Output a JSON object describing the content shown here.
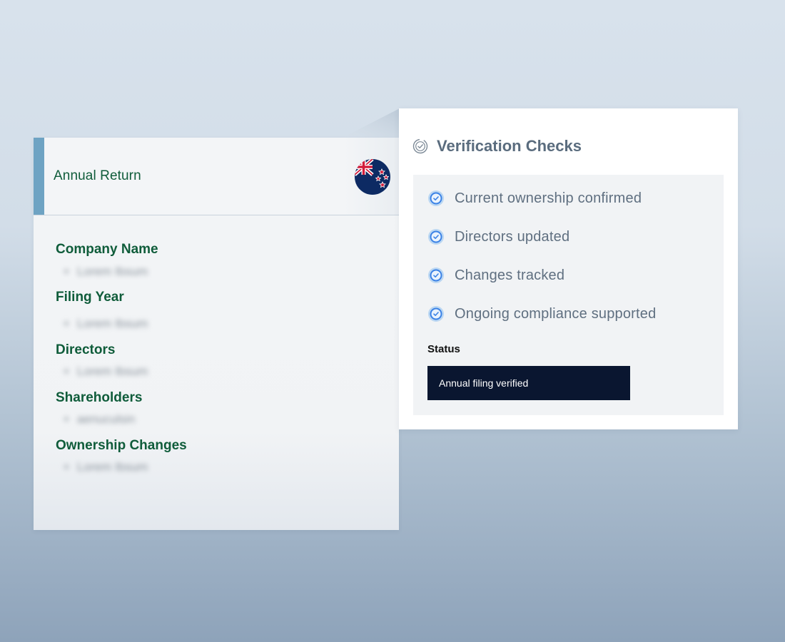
{
  "document": {
    "title": "Annual Return",
    "flag_icon": "new-zealand-flag-icon",
    "accent_color": "#6ea3c3",
    "label_color": "#0f5c3a",
    "fields": [
      {
        "label": "Company Name",
        "value": "Lorem Ibsum"
      },
      {
        "label": "Filing Year",
        "value": "Lorem Ibsum"
      },
      {
        "label": "Directors",
        "value": "Lorem Ibsum"
      },
      {
        "label": "Shareholders",
        "value": "aenuculsin"
      },
      {
        "label": "Ownership Changes",
        "value": "Lorem Ibsum"
      }
    ]
  },
  "verification": {
    "title": "Verification Checks",
    "title_icon": "verified-check-circle-icon",
    "checks": [
      {
        "label": "Current ownership confirmed",
        "icon": "check-badge-icon"
      },
      {
        "label": "Directors updated",
        "icon": "check-badge-icon"
      },
      {
        "label": "Changes tracked",
        "icon": "check-badge-icon"
      },
      {
        "label": "Ongoing compliance supported",
        "icon": "check-badge-icon"
      }
    ],
    "status_label": "Status",
    "status_value": "Annual filing verified",
    "status_bg_color": "#0a1630"
  }
}
